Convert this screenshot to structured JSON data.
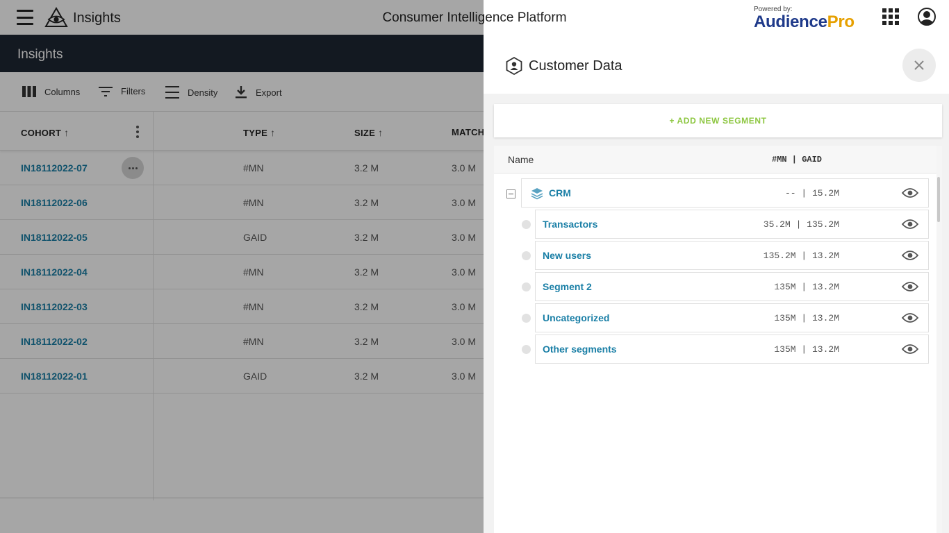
{
  "topbar": {
    "app_title": "Insights",
    "platform_title": "Consumer Intelligence Platform",
    "powered_by": "Powered by:",
    "brand_part1": "Audience",
    "brand_part2": "Pro",
    "brand_color_primary": "#1f3a8a",
    "brand_color_accent": "#e6a000"
  },
  "subheader": {
    "title": "Insights"
  },
  "toolbar": {
    "columns_label": "Columns",
    "filters_label": "Filters",
    "density_label": "Density",
    "export_label": "Export"
  },
  "table": {
    "headers": {
      "cohort": "COHORT",
      "type": "TYPE",
      "size": "SIZE",
      "match": "MATCH"
    },
    "sort_arrow": "↑",
    "rows": [
      {
        "cohort": "IN18112022-07",
        "type": "#MN",
        "size": "3.2 M",
        "match": "3.0 M"
      },
      {
        "cohort": "IN18112022-06",
        "type": "#MN",
        "size": "3.2 M",
        "match": "3.0 M"
      },
      {
        "cohort": "IN18112022-05",
        "type": "GAID",
        "size": "3.2 M",
        "match": "3.0 M"
      },
      {
        "cohort": "IN18112022-04",
        "type": "#MN",
        "size": "3.2 M",
        "match": "3.0 M"
      },
      {
        "cohort": "IN18112022-03",
        "type": "#MN",
        "size": "3.2 M",
        "match": "3.0 M"
      },
      {
        "cohort": "IN18112022-02",
        "type": "#MN",
        "size": "3.2 M",
        "match": "3.0 M"
      },
      {
        "cohort": "IN18112022-01",
        "type": "GAID",
        "size": "3.2 M",
        "match": "3.0 M"
      }
    ]
  },
  "drawer": {
    "title": "Customer Data",
    "add_segment_label": "+ ADD NEW SEGMENT",
    "add_segment_color": "#8cc63f",
    "list_header": {
      "name": "Name",
      "cols": "#MN | GAID"
    },
    "group": {
      "label": "CRM",
      "values": "-- | 15.2M"
    },
    "segments": [
      {
        "label": "Transactors",
        "values": "35.2M | 135.2M"
      },
      {
        "label": "New users",
        "values": "135.2M | 13.2M"
      },
      {
        "label": "Segment 2",
        "values": "135M | 13.2M"
      },
      {
        "label": "Uncategorized",
        "values": "135M | 13.2M"
      },
      {
        "label": "Other segments",
        "values": "135M | 13.2M"
      }
    ]
  },
  "icons": {
    "menu": "hamburger-icon",
    "logo": "eye-pyramid-icon",
    "apps": "apps-grid-icon",
    "account": "account-circle-icon",
    "drawer": "customer-hexagon-icon",
    "close": "close-icon",
    "layers": "layers-icon",
    "visibility": "eye-icon"
  }
}
